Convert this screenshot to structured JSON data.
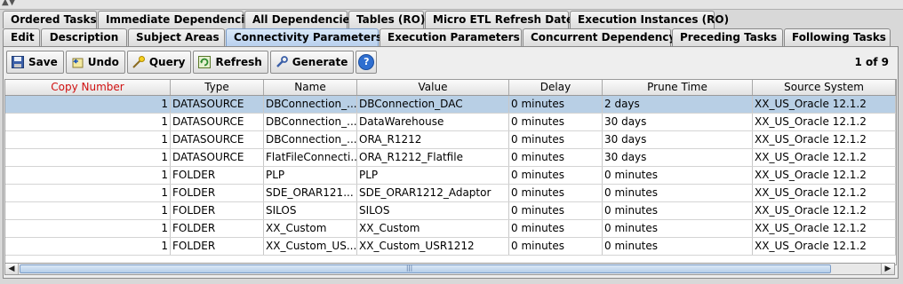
{
  "tabs_row1": [
    "Ordered Tasks",
    "Immediate Dependencies",
    "All Dependencies",
    "Tables (RO)",
    "Micro ETL Refresh Dates",
    "Execution Instances (RO)"
  ],
  "tabs_row2": [
    "Edit",
    "Description",
    "Subject Areas",
    "Connectivity Parameters",
    "Execution Parameters",
    "Concurrent Dependency",
    "Preceding Tasks",
    "Following Tasks"
  ],
  "active_tab": "Connectivity Parameters",
  "toolbar": {
    "save": "Save",
    "undo": "Undo",
    "query": "Query",
    "refresh": "Refresh",
    "generate": "Generate",
    "help": "?"
  },
  "pager": "1 of 9",
  "colors": {
    "selected_row": "#b8cfe5",
    "required_header": "#d01010",
    "active_tab": "#b8d0ee"
  },
  "table": {
    "columns": [
      "Copy Number",
      "Type",
      "Name",
      "Value",
      "Delay",
      "Prune Time",
      "Source System"
    ],
    "rows": [
      [
        "1",
        "DATASOURCE",
        "DBConnection_...",
        "DBConnection_DAC",
        "0 minutes",
        "2 days",
        "XX_US_Oracle 12.1.2"
      ],
      [
        "1",
        "DATASOURCE",
        "DBConnection_...",
        "DataWarehouse",
        "0 minutes",
        "30 days",
        "XX_US_Oracle 12.1.2"
      ],
      [
        "1",
        "DATASOURCE",
        "DBConnection_...",
        "ORA_R1212",
        "0 minutes",
        "30 days",
        "XX_US_Oracle 12.1.2"
      ],
      [
        "1",
        "DATASOURCE",
        "FlatFileConnecti...",
        "ORA_R1212_Flatfile",
        "0 minutes",
        "30 days",
        "XX_US_Oracle 12.1.2"
      ],
      [
        "1",
        "FOLDER",
        "PLP",
        "PLP",
        "0 minutes",
        "0 minutes",
        "XX_US_Oracle 12.1.2"
      ],
      [
        "1",
        "FOLDER",
        "SDE_ORAR121...",
        "SDE_ORAR1212_Adaptor",
        "0 minutes",
        "0 minutes",
        "XX_US_Oracle 12.1.2"
      ],
      [
        "1",
        "FOLDER",
        "SILOS",
        "SILOS",
        "0 minutes",
        "0 minutes",
        "XX_US_Oracle 12.1.2"
      ],
      [
        "1",
        "FOLDER",
        "XX_Custom",
        "XX_Custom",
        "0 minutes",
        "0 minutes",
        "XX_US_Oracle 12.1.2"
      ],
      [
        "1",
        "FOLDER",
        "XX_Custom_US...",
        "XX_Custom_USR1212",
        "0 minutes",
        "0 minutes",
        "XX_US_Oracle 12.1.2"
      ]
    ]
  }
}
